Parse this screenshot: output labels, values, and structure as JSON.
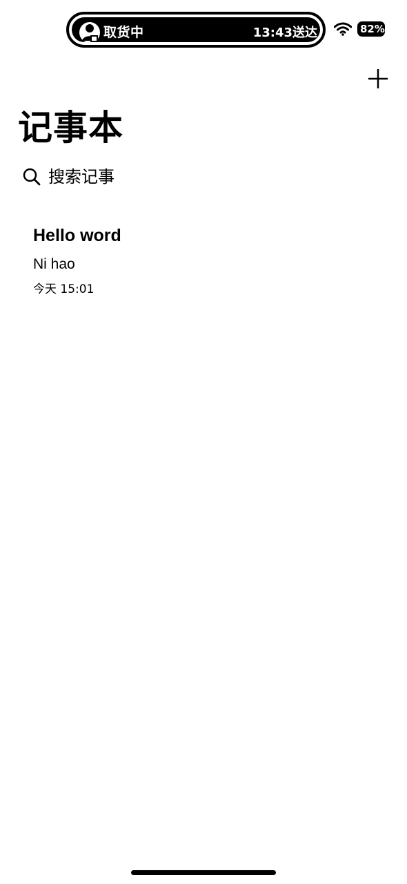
{
  "status_bar": {
    "live_activity": {
      "status_text": "取货中",
      "time_text": "13:43送达"
    },
    "battery_level": "82%"
  },
  "header": {
    "title": "记事本",
    "add_icon": "plus-icon"
  },
  "search": {
    "placeholder": "搜索记事",
    "icon": "search-icon"
  },
  "notes": [
    {
      "title": "Hello word",
      "body": "Ni hao",
      "time": "今天 15:01"
    }
  ],
  "colors": {
    "background": "#ffffff",
    "text": "#000000"
  }
}
